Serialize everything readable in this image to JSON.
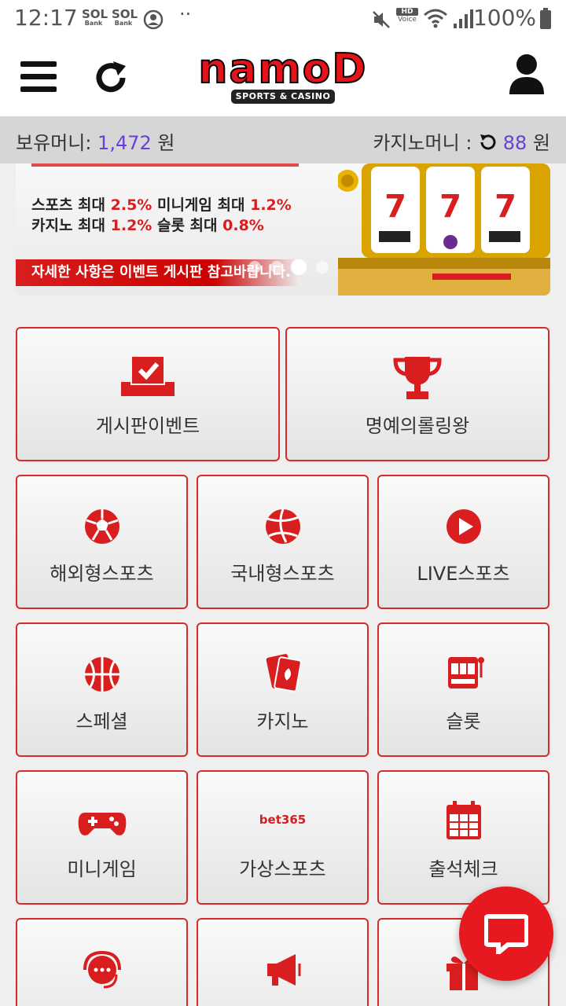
{
  "status_bar": {
    "time": "12:17",
    "bank_icon_1": "SOL Bank",
    "bank_icon_2": "SOL Bank",
    "more": "··",
    "hd_voice": "HD Voice",
    "battery": "100%"
  },
  "header": {
    "logo_text": "namoD",
    "logo_sub": "SPORTS & CASINO",
    "menu_icon": "hamburger-icon",
    "refresh_icon": "refresh-icon",
    "user_icon": "user-icon"
  },
  "money": {
    "owned_label": "보유머니:",
    "owned_value": "1,472",
    "owned_unit": "원",
    "casino_label": "카지노머니 :",
    "casino_value": "88",
    "casino_unit": "원"
  },
  "banner": {
    "line1_a": "스포츠 최대",
    "line1_b": "2.5%",
    "line1_c": "미니게임 최대",
    "line1_d": "1.2%",
    "line2_a": "카지노 최대",
    "line2_b": "1.2%",
    "line2_c": "슬롯 최대",
    "line2_d": "0.8%",
    "ribbon": "자세한 사항은 이벤트 게시판 참고바랍니다."
  },
  "tiles": [
    {
      "label": "게시판이벤트",
      "icon": "ballot-check-icon"
    },
    {
      "label": "명예의롤링왕",
      "icon": "trophy-icon"
    },
    {
      "label": "해외형스포츠",
      "icon": "soccer-ball-icon"
    },
    {
      "label": "국내형스포츠",
      "icon": "volleyball-icon"
    },
    {
      "label": "LIVE스포츠",
      "icon": "play-icon"
    },
    {
      "label": "스페셜",
      "icon": "basketball-icon"
    },
    {
      "label": "카지노",
      "icon": "cards-icon"
    },
    {
      "label": "슬롯",
      "icon": "slot-machine-icon"
    },
    {
      "label": "미니게임",
      "icon": "gamepad-icon"
    },
    {
      "label": "가상스포츠",
      "icon": "bet365-icon"
    },
    {
      "label": "출석체크",
      "icon": "calendar-icon"
    },
    {
      "label": "",
      "icon": "headset-chat-icon"
    },
    {
      "label": "",
      "icon": "megaphone-icon"
    },
    {
      "label": "",
      "icon": "gift-icon"
    }
  ],
  "bet365_text": "bet365",
  "chat_button_icon": "chat-bubble-icon",
  "colors": {
    "brand_red": "#e3141a",
    "tile_border": "#d82a2a",
    "money_value": "#6b3fd6"
  }
}
